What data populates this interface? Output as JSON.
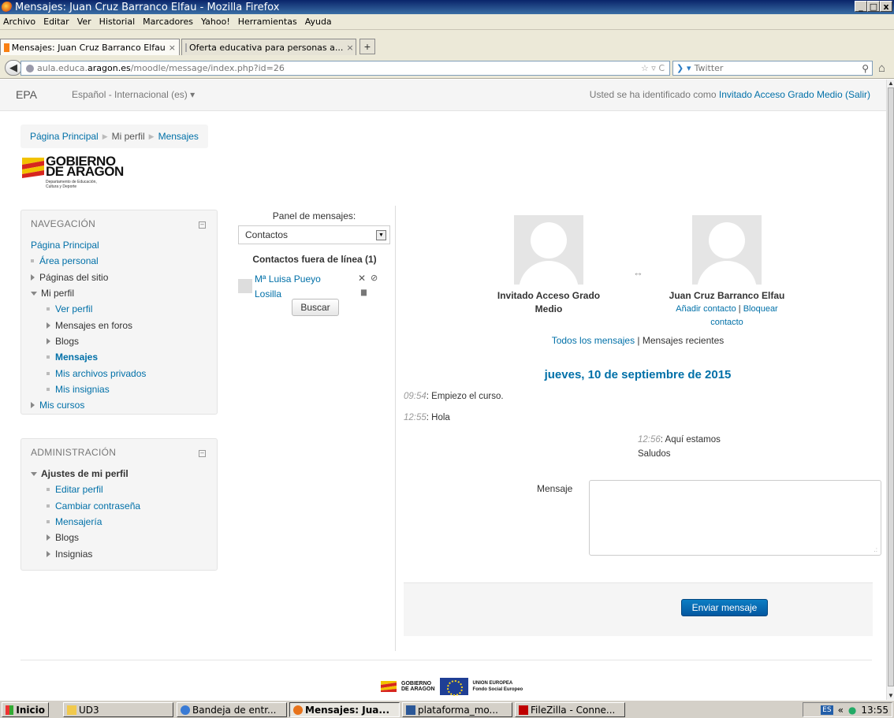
{
  "window": {
    "title": "Mensajes: Juan Cruz Barranco Elfau - Mozilla Firefox",
    "controls": [
      "_",
      "□",
      "x"
    ]
  },
  "menu": [
    "Archivo",
    "Editar",
    "Ver",
    "Historial",
    "Marcadores",
    "Yahoo!",
    "Herramientas",
    "Ayuda"
  ],
  "tabs": [
    {
      "label": "Mensajes: Juan Cruz Barranco Elfau",
      "active": true
    },
    {
      "label": "Oferta educativa para personas a...",
      "active": false
    }
  ],
  "address": {
    "pre": "aula.educa.",
    "domain": "aragon.es",
    "path": "/moodle/message/index.php?id=26",
    "search_placeholder": "Twitter"
  },
  "moodle_nav": {
    "brand": "EPA",
    "language": "Español - Internacional (es)",
    "login_prefix": "Usted se ha identificado como",
    "user": "Invitado Acceso Grado Medio",
    "logout": "(Salir)"
  },
  "breadcrumb": [
    "Página Principal",
    "Mi perfil",
    "Mensajes"
  ],
  "logo": {
    "line1": "GOBIERNO",
    "line2": "DE ARAGON",
    "line3": "Departamento de Educación,",
    "line4": "Cultura y Deporte"
  },
  "navigation": {
    "title": "NAVEGACIÓN",
    "home": "Página Principal",
    "items": [
      {
        "label": "Área personal",
        "type": "leaf",
        "indent": 0
      },
      {
        "label": "Páginas del sitio",
        "type": "collapsed",
        "indent": 0
      },
      {
        "label": "Mi perfil",
        "type": "expanded",
        "indent": 0
      },
      {
        "label": "Ver perfil",
        "type": "leaf",
        "indent": 1
      },
      {
        "label": "Mensajes en foros",
        "type": "collapsed",
        "indent": 1
      },
      {
        "label": "Blogs",
        "type": "collapsed",
        "indent": 1
      },
      {
        "label": "Mensajes",
        "type": "leaf-active",
        "indent": 1
      },
      {
        "label": "Mis archivos privados",
        "type": "leaf",
        "indent": 1
      },
      {
        "label": "Mis insignias",
        "type": "leaf",
        "indent": 1
      },
      {
        "label": "Mis cursos",
        "type": "collapsed-link",
        "indent": 0
      }
    ]
  },
  "administration": {
    "title": "ADMINISTRACIÓN",
    "section": "Ajustes de mi perfil",
    "items": [
      {
        "label": "Editar perfil",
        "type": "leaf"
      },
      {
        "label": "Cambiar contraseña",
        "type": "leaf"
      },
      {
        "label": "Mensajería",
        "type": "leaf"
      },
      {
        "label": "Blogs",
        "type": "collapsed"
      },
      {
        "label": "Insignias",
        "type": "collapsed"
      }
    ]
  },
  "message_panel": {
    "title": "Panel de mensajes:",
    "selected": "Contactos",
    "offline_heading": "Contactos fuera de línea (1)",
    "contact_name": "Mª Luisa Pueyo Losilla",
    "search_button": "Buscar"
  },
  "conversation": {
    "me": "Invitado Acceso Grado Medio",
    "other": "Juan Cruz Barranco Elfau",
    "add_contact": "Añadir contacto",
    "block_contact": "Bloquear contacto",
    "all_messages": "Todos los mensajes",
    "recent_messages": "Mensajes recientes",
    "date": "jueves, 10 de septiembre de 2015",
    "messages": [
      {
        "time": "09:54",
        "text": "Empiezo el curso."
      },
      {
        "time": "12:55",
        "text": "Hola"
      },
      {
        "time": "12:56",
        "text": "Aquí estamos",
        "text2": "Saludos"
      }
    ],
    "compose_label": "Mensaje",
    "send_button": "Enviar mensaje"
  },
  "footer": {
    "logo_a_1": "GOBIERNO",
    "logo_a_2": "DE ARAGON",
    "logo_b_1": "UNION EUROPEA",
    "logo_b_2": "Fondo Social Europeo"
  },
  "taskbar": {
    "start": "Inicio",
    "items": [
      "UD3",
      "Bandeja de entr...",
      "Mensajes: Jua...",
      "plataforma_mo...",
      "FileZilla - Conne..."
    ],
    "lang": "ES",
    "clock": "13:55"
  }
}
